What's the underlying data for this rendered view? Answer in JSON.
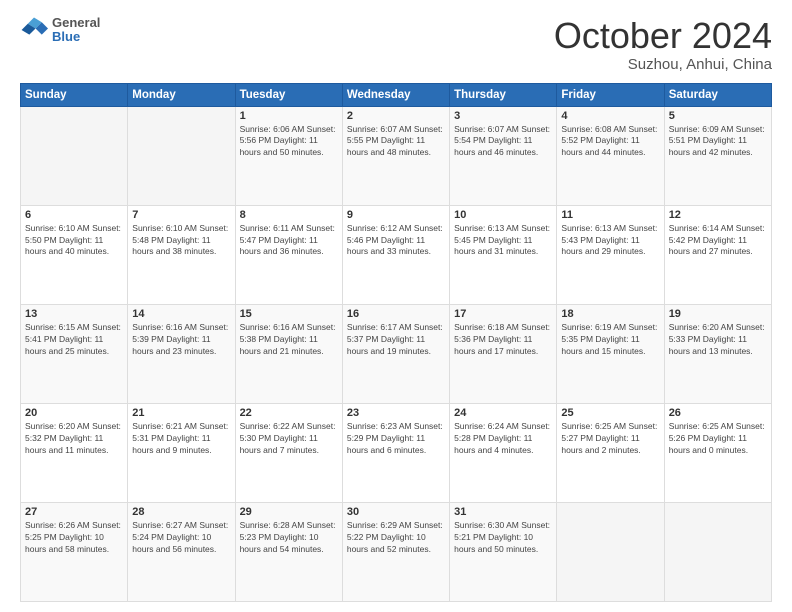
{
  "logo": {
    "general": "General",
    "blue": "Blue"
  },
  "title": "October 2024",
  "location": "Suzhou, Anhui, China",
  "weekdays": [
    "Sunday",
    "Monday",
    "Tuesday",
    "Wednesday",
    "Thursday",
    "Friday",
    "Saturday"
  ],
  "weeks": [
    [
      {
        "day": "",
        "info": ""
      },
      {
        "day": "",
        "info": ""
      },
      {
        "day": "1",
        "info": "Sunrise: 6:06 AM\nSunset: 5:56 PM\nDaylight: 11 hours and 50 minutes."
      },
      {
        "day": "2",
        "info": "Sunrise: 6:07 AM\nSunset: 5:55 PM\nDaylight: 11 hours and 48 minutes."
      },
      {
        "day": "3",
        "info": "Sunrise: 6:07 AM\nSunset: 5:54 PM\nDaylight: 11 hours and 46 minutes."
      },
      {
        "day": "4",
        "info": "Sunrise: 6:08 AM\nSunset: 5:52 PM\nDaylight: 11 hours and 44 minutes."
      },
      {
        "day": "5",
        "info": "Sunrise: 6:09 AM\nSunset: 5:51 PM\nDaylight: 11 hours and 42 minutes."
      }
    ],
    [
      {
        "day": "6",
        "info": "Sunrise: 6:10 AM\nSunset: 5:50 PM\nDaylight: 11 hours and 40 minutes."
      },
      {
        "day": "7",
        "info": "Sunrise: 6:10 AM\nSunset: 5:48 PM\nDaylight: 11 hours and 38 minutes."
      },
      {
        "day": "8",
        "info": "Sunrise: 6:11 AM\nSunset: 5:47 PM\nDaylight: 11 hours and 36 minutes."
      },
      {
        "day": "9",
        "info": "Sunrise: 6:12 AM\nSunset: 5:46 PM\nDaylight: 11 hours and 33 minutes."
      },
      {
        "day": "10",
        "info": "Sunrise: 6:13 AM\nSunset: 5:45 PM\nDaylight: 11 hours and 31 minutes."
      },
      {
        "day": "11",
        "info": "Sunrise: 6:13 AM\nSunset: 5:43 PM\nDaylight: 11 hours and 29 minutes."
      },
      {
        "day": "12",
        "info": "Sunrise: 6:14 AM\nSunset: 5:42 PM\nDaylight: 11 hours and 27 minutes."
      }
    ],
    [
      {
        "day": "13",
        "info": "Sunrise: 6:15 AM\nSunset: 5:41 PM\nDaylight: 11 hours and 25 minutes."
      },
      {
        "day": "14",
        "info": "Sunrise: 6:16 AM\nSunset: 5:39 PM\nDaylight: 11 hours and 23 minutes."
      },
      {
        "day": "15",
        "info": "Sunrise: 6:16 AM\nSunset: 5:38 PM\nDaylight: 11 hours and 21 minutes."
      },
      {
        "day": "16",
        "info": "Sunrise: 6:17 AM\nSunset: 5:37 PM\nDaylight: 11 hours and 19 minutes."
      },
      {
        "day": "17",
        "info": "Sunrise: 6:18 AM\nSunset: 5:36 PM\nDaylight: 11 hours and 17 minutes."
      },
      {
        "day": "18",
        "info": "Sunrise: 6:19 AM\nSunset: 5:35 PM\nDaylight: 11 hours and 15 minutes."
      },
      {
        "day": "19",
        "info": "Sunrise: 6:20 AM\nSunset: 5:33 PM\nDaylight: 11 hours and 13 minutes."
      }
    ],
    [
      {
        "day": "20",
        "info": "Sunrise: 6:20 AM\nSunset: 5:32 PM\nDaylight: 11 hours and 11 minutes."
      },
      {
        "day": "21",
        "info": "Sunrise: 6:21 AM\nSunset: 5:31 PM\nDaylight: 11 hours and 9 minutes."
      },
      {
        "day": "22",
        "info": "Sunrise: 6:22 AM\nSunset: 5:30 PM\nDaylight: 11 hours and 7 minutes."
      },
      {
        "day": "23",
        "info": "Sunrise: 6:23 AM\nSunset: 5:29 PM\nDaylight: 11 hours and 6 minutes."
      },
      {
        "day": "24",
        "info": "Sunrise: 6:24 AM\nSunset: 5:28 PM\nDaylight: 11 hours and 4 minutes."
      },
      {
        "day": "25",
        "info": "Sunrise: 6:25 AM\nSunset: 5:27 PM\nDaylight: 11 hours and 2 minutes."
      },
      {
        "day": "26",
        "info": "Sunrise: 6:25 AM\nSunset: 5:26 PM\nDaylight: 11 hours and 0 minutes."
      }
    ],
    [
      {
        "day": "27",
        "info": "Sunrise: 6:26 AM\nSunset: 5:25 PM\nDaylight: 10 hours and 58 minutes."
      },
      {
        "day": "28",
        "info": "Sunrise: 6:27 AM\nSunset: 5:24 PM\nDaylight: 10 hours and 56 minutes."
      },
      {
        "day": "29",
        "info": "Sunrise: 6:28 AM\nSunset: 5:23 PM\nDaylight: 10 hours and 54 minutes."
      },
      {
        "day": "30",
        "info": "Sunrise: 6:29 AM\nSunset: 5:22 PM\nDaylight: 10 hours and 52 minutes."
      },
      {
        "day": "31",
        "info": "Sunrise: 6:30 AM\nSunset: 5:21 PM\nDaylight: 10 hours and 50 minutes."
      },
      {
        "day": "",
        "info": ""
      },
      {
        "day": "",
        "info": ""
      }
    ]
  ]
}
